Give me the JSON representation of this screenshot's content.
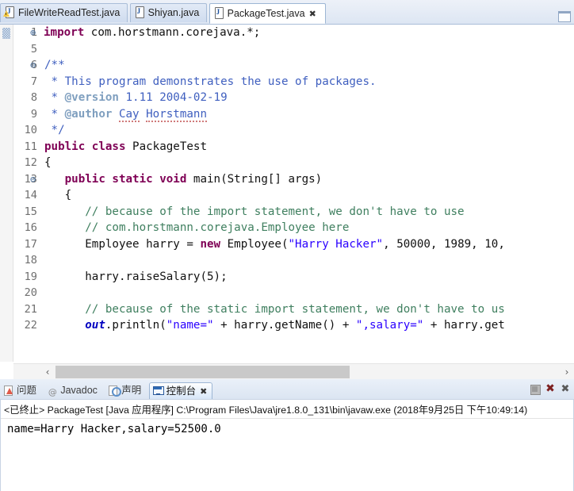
{
  "window": {
    "minimize_label": "minimize"
  },
  "editor": {
    "tabs": [
      {
        "label": "FileWriteReadTest.java",
        "icon": "java-file-warning-icon",
        "active": false,
        "closable": false
      },
      {
        "label": "Shiyan.java",
        "icon": "java-file-icon",
        "active": false,
        "closable": false
      },
      {
        "label": "PackageTest.java",
        "icon": "java-file-icon",
        "active": true,
        "closable": true,
        "close_glyph": "✖"
      }
    ],
    "line_numbers": [
      "1",
      "5",
      "6",
      "7",
      "8",
      "9",
      "10",
      "11",
      "12",
      "13",
      "14",
      "15",
      "16",
      "17",
      "18",
      "19",
      "20",
      "21",
      "22"
    ],
    "fold_markers": [
      "⊕",
      "",
      "⊖",
      "",
      "",
      "",
      "",
      "",
      "",
      "⊖",
      "",
      "",
      "",
      "",
      "",
      "",
      "",
      "",
      ""
    ],
    "lines": [
      "import com.horstmann.corejava.*;",
      "",
      "/**",
      " * This program demonstrates the use of packages.",
      " * @version 1.11 2004-02-19",
      " * @author Cay Horstmann",
      " */",
      "public class PackageTest",
      "{",
      "   public static void main(String[] args)",
      "   {",
      "      // because of the import statement, we don't have to use",
      "      // com.horstmann.corejava.Employee here",
      "      Employee harry = new Employee(\"Harry Hacker\", 50000, 1989, 10,",
      "",
      "      harry.raiseSalary(5);",
      "",
      "      // because of the static import statement, we don't have to us",
      "      out.println(\"name=\" + harry.getName() + \",salary=\" + harry.get"
    ],
    "scroll": {
      "left_arrow": "‹",
      "right_arrow": "›"
    }
  },
  "console_panel": {
    "tabs": [
      {
        "label": "问题",
        "icon": "problems-icon",
        "active": false
      },
      {
        "label": "Javadoc",
        "icon": "javadoc-icon",
        "active": false
      },
      {
        "label": "声明",
        "icon": "declaration-icon",
        "active": false
      },
      {
        "label": "控制台",
        "icon": "console-icon",
        "active": true,
        "close_glyph": "✖"
      }
    ],
    "toolbar": [
      {
        "name": "terminate-button",
        "glyph": ""
      },
      {
        "name": "remove-all-terminated-button",
        "glyph": "✖"
      },
      {
        "name": "remove-launch-button",
        "glyph": "✖"
      }
    ],
    "status_line": "<已终止> PackageTest [Java 应用程序] C:\\Program Files\\Java\\jre1.8.0_131\\bin\\javaw.exe (2018年9月25日 下午10:49:14)",
    "output": "name=Harry Hacker,salary=52500.0"
  },
  "colors": {
    "keyword": "#7f0055",
    "string": "#2a00ff",
    "comment": "#3f7f5f",
    "javadoc": "#3f5fbf",
    "javadoc_tag": "#7f9fbf",
    "static_field": "#0000c0",
    "tab_active_bg": "#ffffff",
    "chrome_bg": "#e8eef7"
  }
}
